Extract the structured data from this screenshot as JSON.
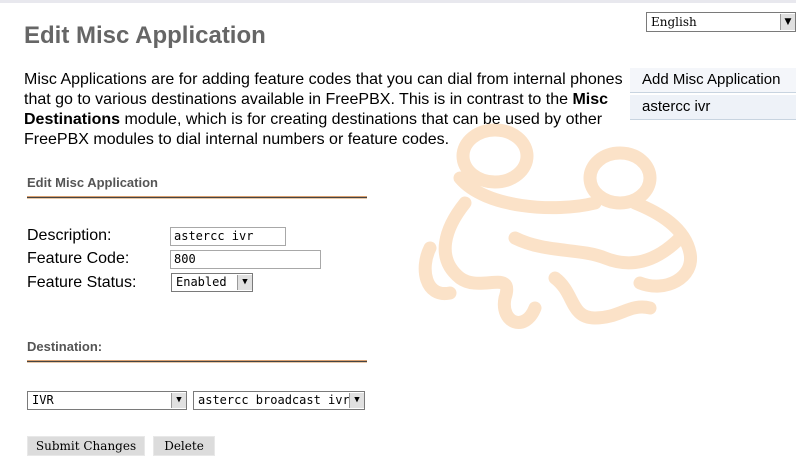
{
  "page": {
    "title": "Edit Misc Application",
    "description_parts": [
      "Misc Applications are for adding feature codes that you can dial from internal phones that go to various destinations available in FreePBX. This is in contrast to the ",
      "Misc Destinations",
      " module, which is for creating destinations that can be used by other FreePBX modules to dial internal numbers or feature codes."
    ]
  },
  "language": {
    "selected": "English"
  },
  "sidebar": {
    "items": [
      {
        "label": "Add Misc Application"
      },
      {
        "label": "astercc ivr"
      }
    ]
  },
  "form": {
    "section_title": "Edit Misc Application",
    "description_label": "Description:",
    "description_value": "astercc ivr",
    "feature_code_label": "Feature Code:",
    "feature_code_value": "800",
    "feature_status_label": "Feature Status:",
    "feature_status_value": "Enabled",
    "destination_title": "Destination:",
    "destination_type": "IVR",
    "destination_target": "astercc broadcast ivr",
    "submit_label": "Submit Changes",
    "delete_label": "Delete"
  },
  "colors": {
    "title": "#666666",
    "watermark": "#fbe4cc",
    "sidebar_bg": "#eef2f8"
  }
}
